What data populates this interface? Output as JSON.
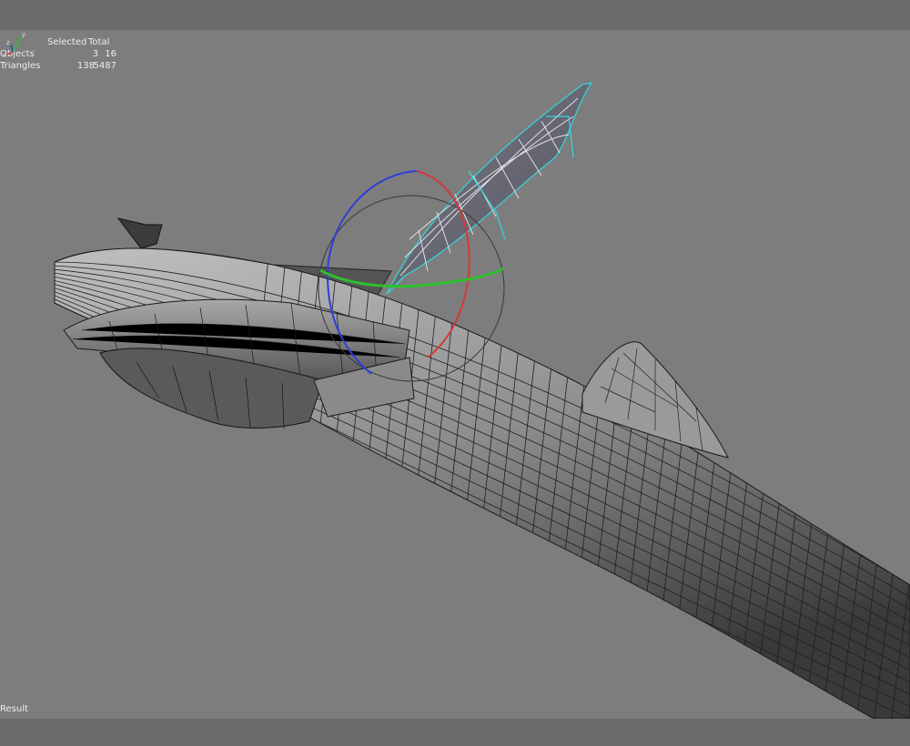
{
  "stats": {
    "col_selected": "Selected",
    "col_total": "Total",
    "rows": [
      {
        "label": "Objects",
        "selected": "3",
        "total": "16"
      },
      {
        "label": "Triangles",
        "selected": "138",
        "total": "5487"
      }
    ]
  },
  "axes": {
    "x_label": "x",
    "y_label": "y",
    "z_label": "z"
  },
  "status_text": "Result",
  "colors": {
    "viewport_bg": "#7d7d7d",
    "frame_bg": "#6a6a6a",
    "selection_wire": "#35d6dc",
    "rotate_x": "#d23a3a",
    "rotate_y": "#2fbf2f",
    "rotate_z": "#2c3fd8"
  }
}
